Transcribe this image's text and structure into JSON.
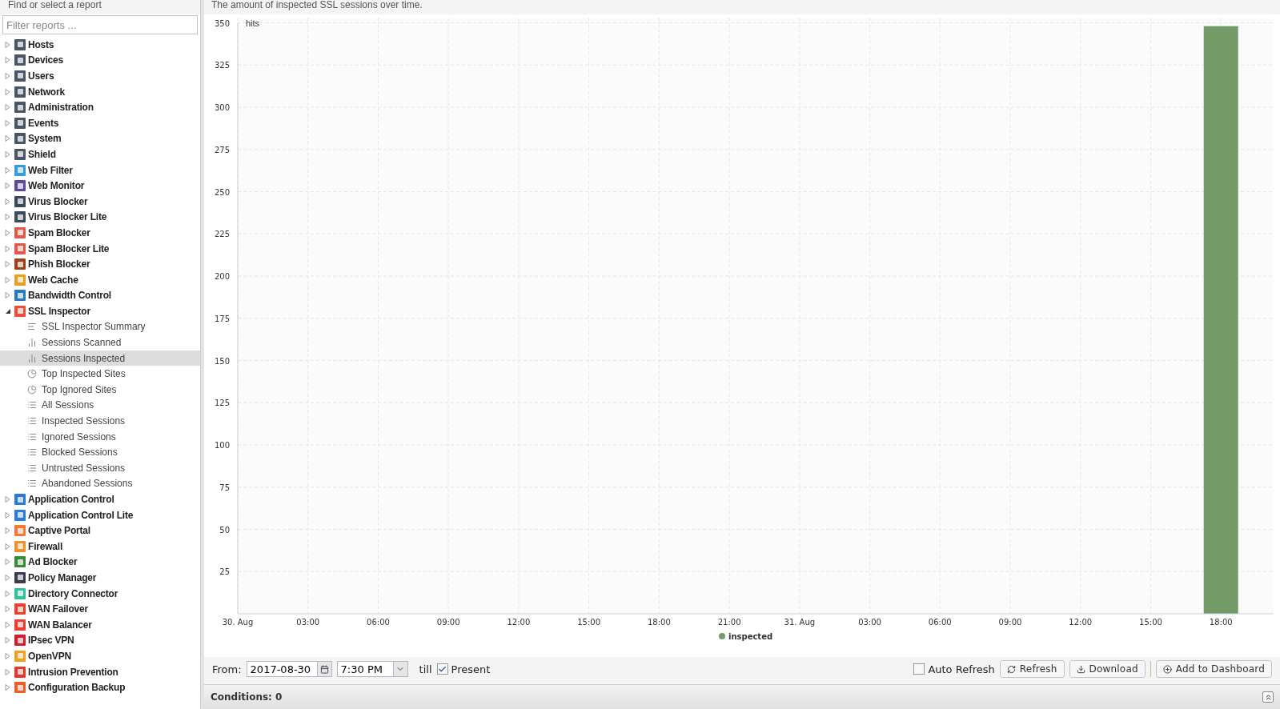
{
  "sidebar": {
    "title": "Find or select a report",
    "filter": {
      "placeholder": "Filter reports ..."
    },
    "items": [
      {
        "label": "Hosts",
        "color": "#4a5565",
        "expanded": false,
        "selected": false
      },
      {
        "label": "Devices",
        "color": "#4a5565",
        "expanded": false,
        "selected": false
      },
      {
        "label": "Users",
        "color": "#4a5565",
        "expanded": false,
        "selected": false
      },
      {
        "label": "Network",
        "color": "#4a5565",
        "expanded": false,
        "selected": false
      },
      {
        "label": "Administration",
        "color": "#4a5565",
        "expanded": false,
        "selected": false
      },
      {
        "label": "Events",
        "color": "#4a5565",
        "expanded": false,
        "selected": false
      },
      {
        "label": "System",
        "color": "#4a5565",
        "expanded": false,
        "selected": false
      },
      {
        "label": "Shield",
        "color": "#4a5565",
        "expanded": false,
        "selected": false
      },
      {
        "label": "Web Filter",
        "color": "#3a9ad9",
        "expanded": false,
        "selected": false
      },
      {
        "label": "Web Monitor",
        "color": "#5b4a9a",
        "expanded": false,
        "selected": false
      },
      {
        "label": "Virus Blocker",
        "color": "#3a4a5a",
        "expanded": false,
        "selected": false
      },
      {
        "label": "Virus Blocker Lite",
        "color": "#3a4a5a",
        "expanded": false,
        "selected": false
      },
      {
        "label": "Spam Blocker",
        "color": "#e05a4a",
        "expanded": false,
        "selected": false
      },
      {
        "label": "Spam Blocker Lite",
        "color": "#e05a4a",
        "expanded": false,
        "selected": false
      },
      {
        "label": "Phish Blocker",
        "color": "#a0401a",
        "expanded": false,
        "selected": false
      },
      {
        "label": "Web Cache",
        "color": "#e8a020",
        "expanded": false,
        "selected": false
      },
      {
        "label": "Bandwidth Control",
        "color": "#2a7ab8",
        "expanded": false,
        "selected": false
      },
      {
        "label": "SSL Inspector",
        "color": "#e8503a",
        "expanded": true,
        "selected": false,
        "children": [
          {
            "label": "SSL Inspector Summary",
            "kind": "summary",
            "selected": false
          },
          {
            "label": "Sessions Scanned",
            "kind": "bar",
            "selected": false
          },
          {
            "label": "Sessions Inspected",
            "kind": "bar",
            "selected": true
          },
          {
            "label": "Top Inspected Sites",
            "kind": "pie",
            "selected": false
          },
          {
            "label": "Top Ignored Sites",
            "kind": "pie",
            "selected": false
          },
          {
            "label": "All Sessions",
            "kind": "list",
            "selected": false
          },
          {
            "label": "Inspected Sessions",
            "kind": "list",
            "selected": false
          },
          {
            "label": "Ignored Sessions",
            "kind": "list",
            "selected": false
          },
          {
            "label": "Blocked Sessions",
            "kind": "list",
            "selected": false
          },
          {
            "label": "Untrusted Sessions",
            "kind": "list",
            "selected": false
          },
          {
            "label": "Abandoned Sessions",
            "kind": "list",
            "selected": false
          }
        ]
      },
      {
        "label": "Application Control",
        "color": "#2a7ad8",
        "expanded": false,
        "selected": false
      },
      {
        "label": "Application Control Lite",
        "color": "#2a7ad8",
        "expanded": false,
        "selected": false
      },
      {
        "label": "Captive Portal",
        "color": "#f07a3a",
        "expanded": false,
        "selected": false
      },
      {
        "label": "Firewall",
        "color": "#f0902a",
        "expanded": false,
        "selected": false
      },
      {
        "label": "Ad Blocker",
        "color": "#3a8a3a",
        "expanded": false,
        "selected": false
      },
      {
        "label": "Policy Manager",
        "color": "#3a3a4a",
        "expanded": false,
        "selected": false
      },
      {
        "label": "Directory Connector",
        "color": "#30c0a0",
        "expanded": false,
        "selected": false
      },
      {
        "label": "WAN Failover",
        "color": "#e8402a",
        "expanded": false,
        "selected": false
      },
      {
        "label": "WAN Balancer",
        "color": "#e8402a",
        "expanded": false,
        "selected": false
      },
      {
        "label": "IPsec VPN",
        "color": "#d02030",
        "expanded": false,
        "selected": false
      },
      {
        "label": "OpenVPN",
        "color": "#f0a020",
        "expanded": false,
        "selected": false
      },
      {
        "label": "Intrusion Prevention",
        "color": "#e03a2a",
        "expanded": false,
        "selected": false
      },
      {
        "label": "Configuration Backup",
        "color": "#e8602a",
        "expanded": false,
        "selected": false
      }
    ]
  },
  "report": {
    "description": "The amount of inspected SSL sessions over time.",
    "chart_data": {
      "type": "bar",
      "ylabel": "hits",
      "grid": true,
      "x": [
        "2017-08-31 18:00"
      ],
      "series": [
        {
          "name": "inspected",
          "color": "#739a67",
          "values": [
            348
          ]
        }
      ],
      "xlim": [
        "2017-08-30 00:00",
        "2017-08-31 20:15"
      ],
      "ylim": [
        0,
        350
      ],
      "yticks": [
        25,
        50,
        75,
        100,
        125,
        150,
        175,
        200,
        225,
        250,
        275,
        300,
        325,
        350
      ],
      "xticks": [
        {
          "value": "2017-08-30 00:00",
          "label": "30. Aug"
        },
        {
          "value": "2017-08-30 03:00",
          "label": "03:00"
        },
        {
          "value": "2017-08-30 06:00",
          "label": "06:00"
        },
        {
          "value": "2017-08-30 09:00",
          "label": "09:00"
        },
        {
          "value": "2017-08-30 12:00",
          "label": "12:00"
        },
        {
          "value": "2017-08-30 15:00",
          "label": "15:00"
        },
        {
          "value": "2017-08-30 18:00",
          "label": "18:00"
        },
        {
          "value": "2017-08-30 21:00",
          "label": "21:00"
        },
        {
          "value": "2017-08-31 00:00",
          "label": "31. Aug"
        },
        {
          "value": "2017-08-31 03:00",
          "label": "03:00"
        },
        {
          "value": "2017-08-31 06:00",
          "label": "06:00"
        },
        {
          "value": "2017-08-31 09:00",
          "label": "09:00"
        },
        {
          "value": "2017-08-31 12:00",
          "label": "12:00"
        },
        {
          "value": "2017-08-31 15:00",
          "label": "15:00"
        },
        {
          "value": "2017-08-31 18:00",
          "label": "18:00"
        }
      ]
    }
  },
  "toolbar": {
    "from_label": "From:",
    "date": "2017-08-30",
    "time": "7:30 PM",
    "till_label": "till",
    "present": {
      "label": "Present",
      "checked": true
    },
    "auto_refresh": {
      "label": "Auto Refresh",
      "checked": false
    },
    "buttons": [
      {
        "label": "Refresh",
        "kind": "refresh"
      },
      {
        "label": "Download",
        "kind": "download"
      },
      {
        "label": "Add to Dashboard",
        "kind": "add"
      }
    ]
  },
  "conditions": {
    "label": "Conditions: 0"
  }
}
